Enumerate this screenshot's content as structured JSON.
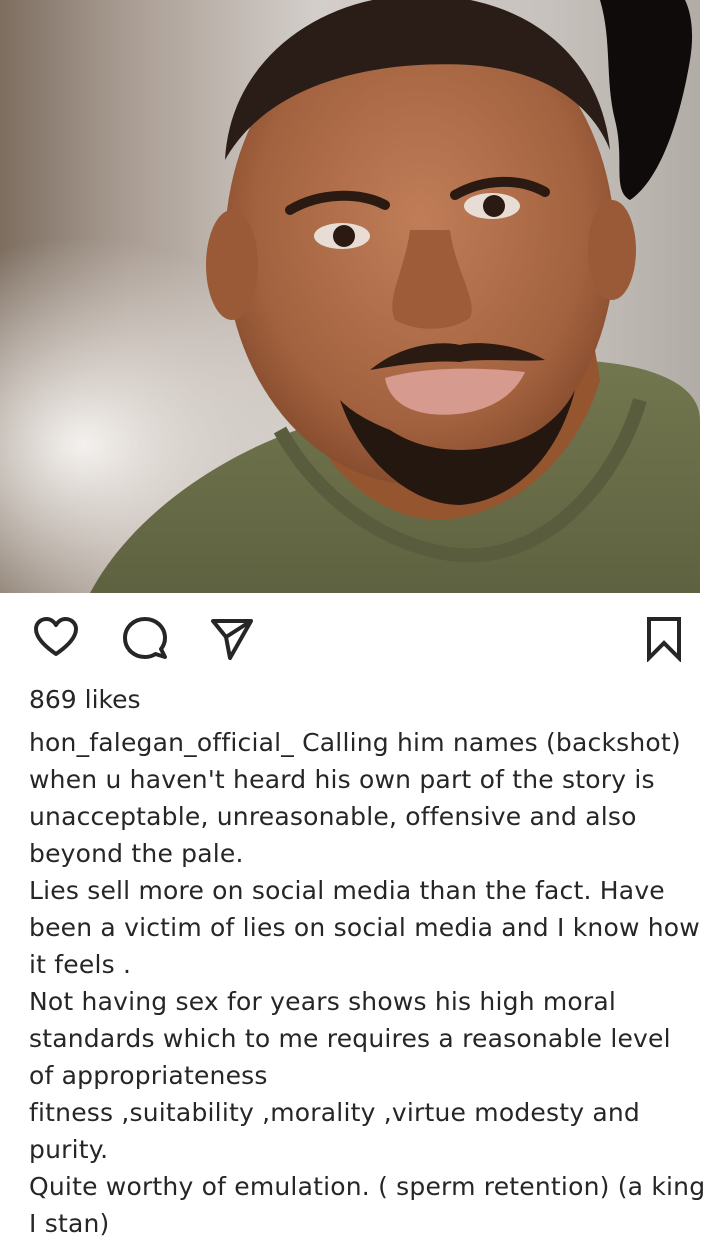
{
  "post": {
    "image_alt": "Portrait of a smiling man with a goatee beard wearing an olive green t-shirt",
    "likes_text": "869 likes",
    "username": "hon_falegan_official_",
    "caption_lines": [
      "Calling him names (backshot)",
      "when u haven't heard his own part of the story is",
      "unacceptable, unreasonable, offensive and also",
      "beyond the pale.",
      "Lies sell more on social media than the fact. Have",
      "been a victim of lies on social media and I know how",
      "it feels .",
      "Not having sex for years shows his high moral",
      "standards which to me requires a reasonable level",
      "of appropriateness",
      "fitness ,suitability ,morality ,virtue modesty and",
      "purity.",
      "Quite worthy of emulation. ( sperm retention) (a king",
      "I stan)"
    ]
  },
  "icons": {
    "like": "heart-outline-icon",
    "comment": "speech-bubble-icon",
    "share": "paper-plane-icon",
    "save": "bookmark-icon"
  },
  "colors": {
    "text": "#262626",
    "background": "#ffffff",
    "shirt": "#6e7250",
    "skin": "#b0704f"
  }
}
